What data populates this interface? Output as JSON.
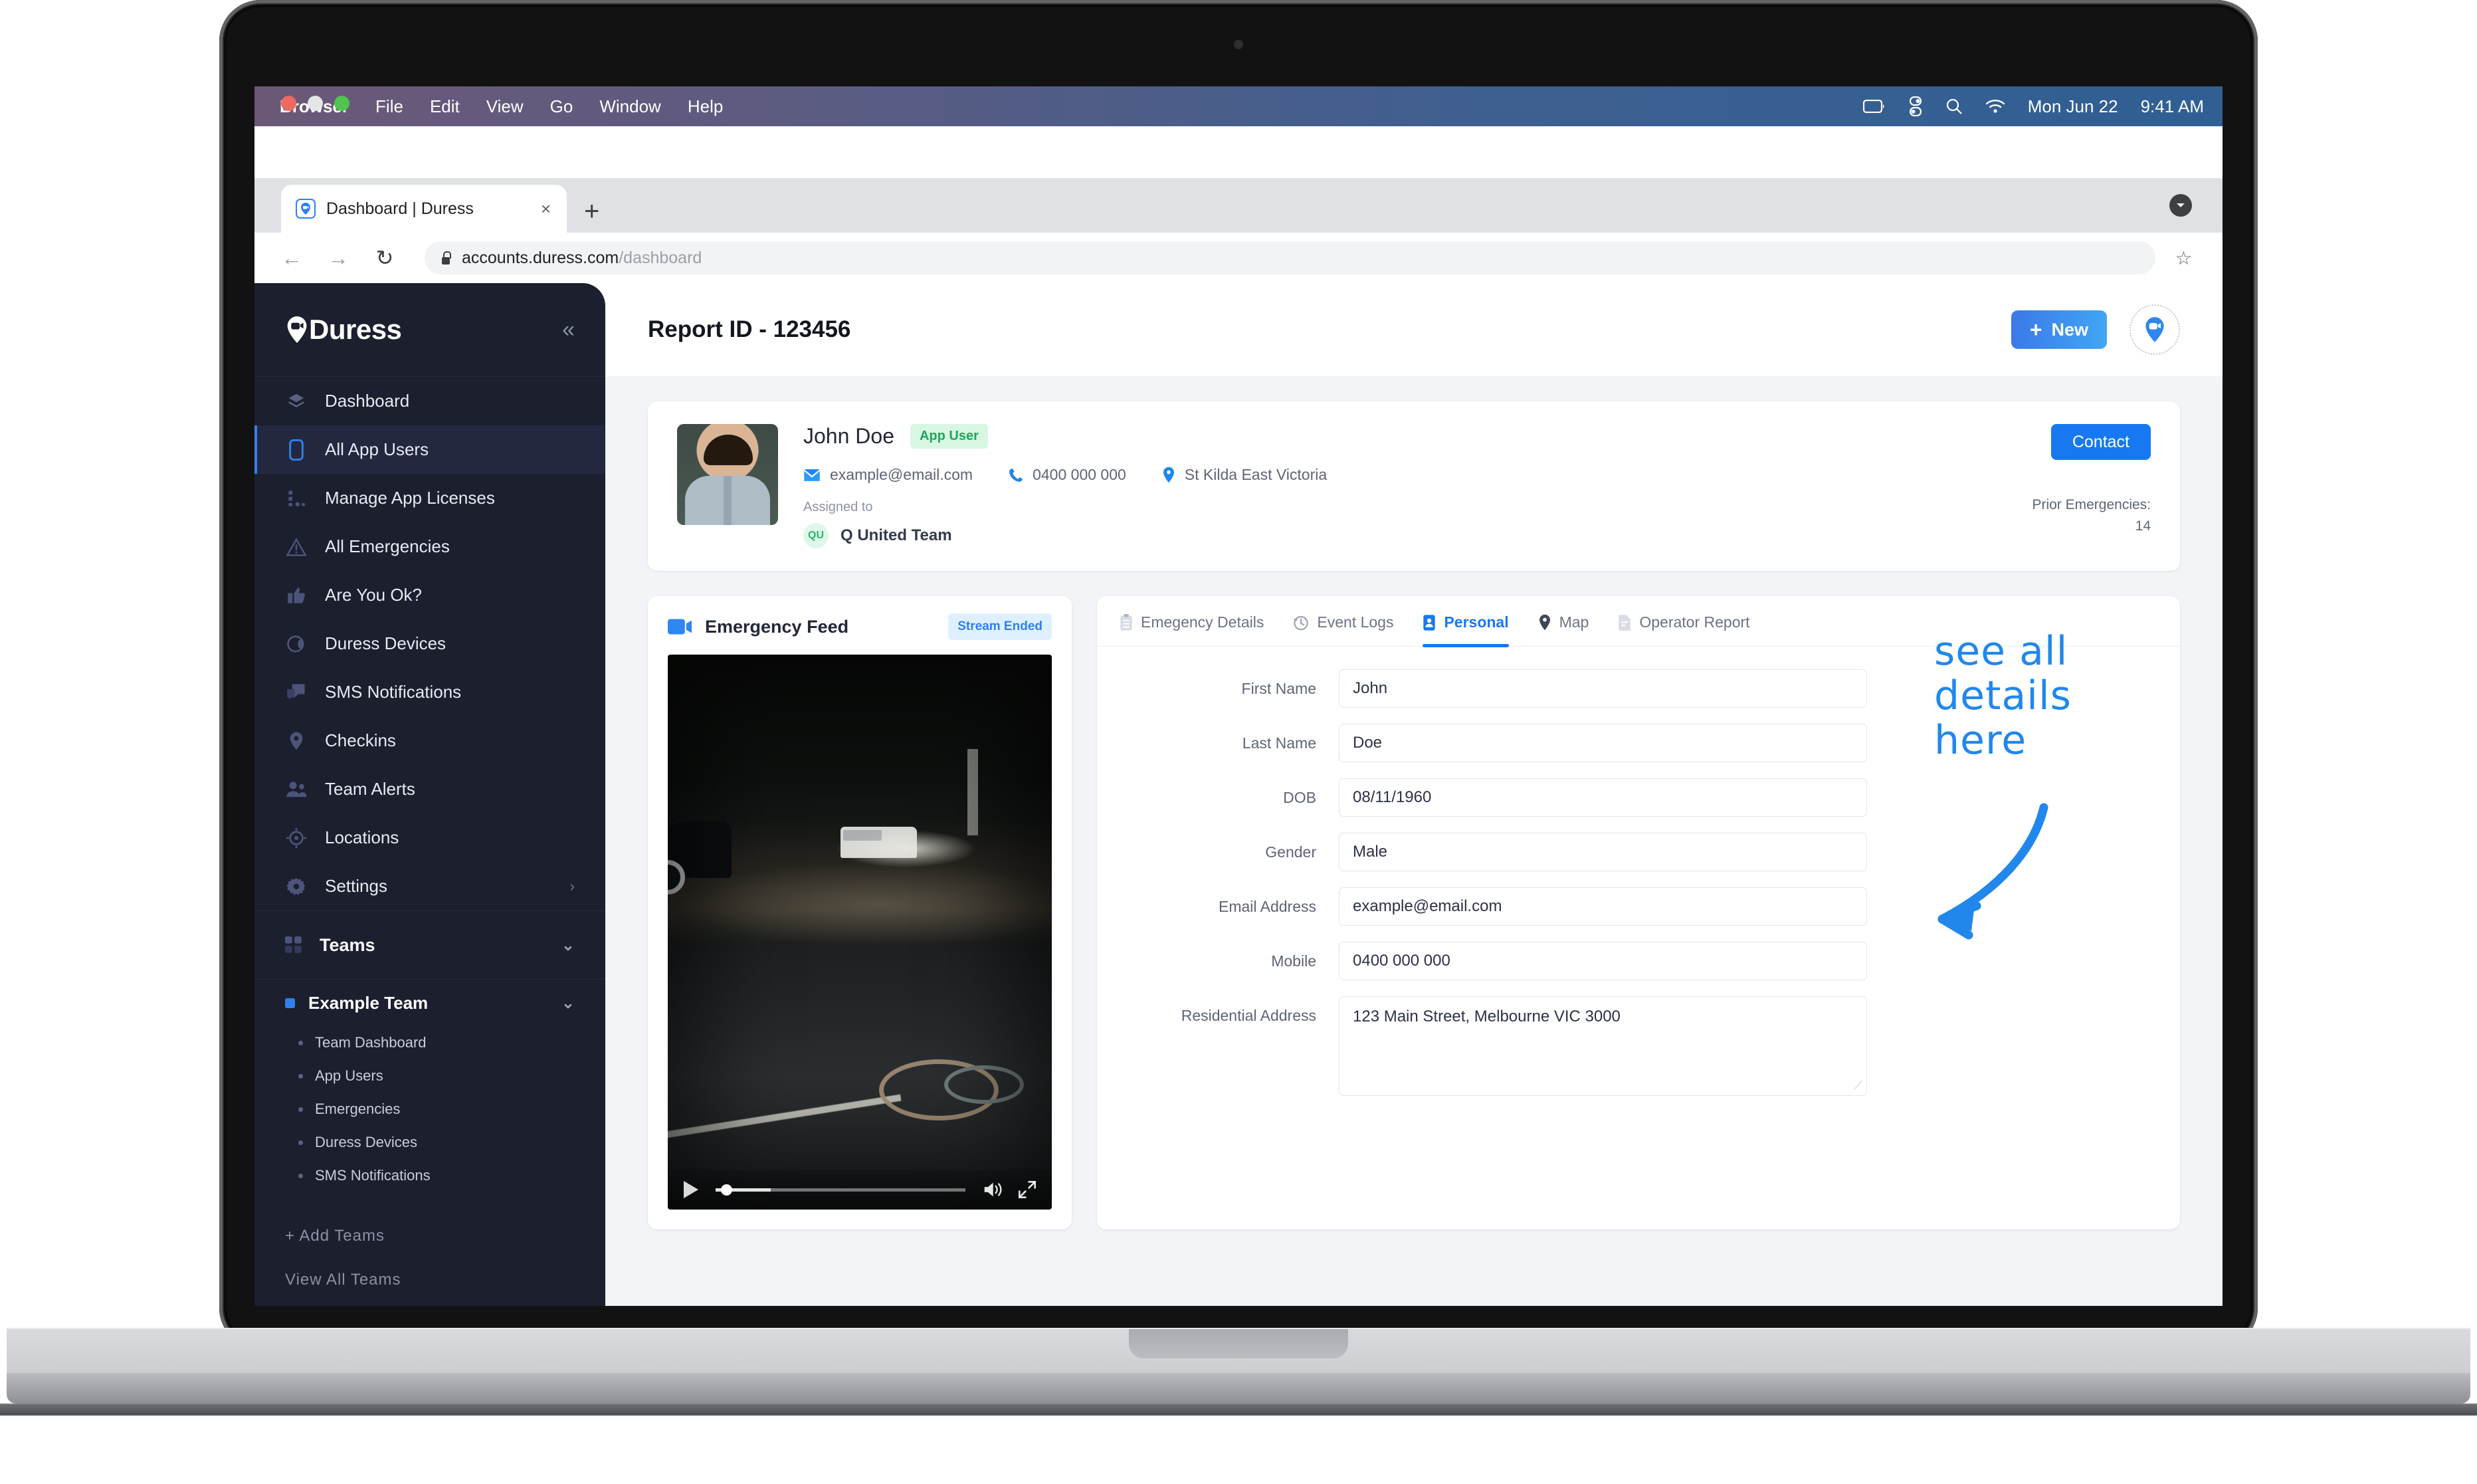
{
  "os_menubar": {
    "items": [
      "Browser",
      "File",
      "Edit",
      "View",
      "Go",
      "Window",
      "Help"
    ],
    "status_icons": [
      "battery-icon",
      "control-center-icon",
      "search-icon",
      "wifi-icon"
    ],
    "date": "Mon Jun 22",
    "time": "9:41 AM"
  },
  "browser": {
    "tab_title": "Dashboard | Duress",
    "tab_favicon": "duress-pin-icon",
    "tab_close": "×",
    "new_tab": "+",
    "back": "←",
    "forward": "→",
    "reload": "↻",
    "url_host": "accounts.duress.com",
    "url_path": "/dashboard",
    "bookmark": "☆",
    "menu": "chrome-menu-icon"
  },
  "sidebar": {
    "brand": "Duress",
    "collapse": "«",
    "items": [
      {
        "label": "Dashboard",
        "icon": "layers-icon",
        "active": false
      },
      {
        "label": "All App Users",
        "icon": "phone-icon",
        "active": true
      },
      {
        "label": "Manage App Licenses",
        "icon": "grid-dots-icon",
        "active": false
      },
      {
        "label": "All Emergencies",
        "icon": "warning-triangle-icon",
        "active": false
      },
      {
        "label": "Are You Ok?",
        "icon": "thumbs-up-icon",
        "active": false
      },
      {
        "label": "Duress Devices",
        "icon": "device-circle-icon",
        "active": false
      },
      {
        "label": "SMS Notifications",
        "icon": "chat-bubbles-icon",
        "active": false
      },
      {
        "label": "Checkins",
        "icon": "map-pin-icon",
        "active": false
      },
      {
        "label": "Team Alerts",
        "icon": "people-icon",
        "active": false
      },
      {
        "label": "Locations",
        "icon": "crosshair-icon",
        "active": false
      },
      {
        "label": "Settings",
        "icon": "gear-icon",
        "active": false,
        "chevron": "›"
      }
    ],
    "teams_section": {
      "label": "Teams",
      "icon": "grid-squares-icon",
      "chevron": "⌄"
    },
    "team": {
      "label": "Example Team",
      "chevron": "⌄"
    },
    "team_children": [
      "Team Dashboard",
      "App Users",
      "Emergencies",
      "Duress Devices",
      "SMS Notifications"
    ],
    "add_teams": "+ Add Teams",
    "view_all_teams": "View All Teams"
  },
  "topbar": {
    "title": "Report ID - 123456",
    "new_button": "New",
    "new_button_plus": "+",
    "avatar_icon": "duress-pin-icon"
  },
  "profile": {
    "name": "John Doe",
    "badge": "App User",
    "email": "example@email.com",
    "phone": "0400 000 000",
    "location": "St Kilda East Victoria",
    "assigned_to_label": "Assigned to",
    "team_initials": "QU",
    "team_name": "Q United Team",
    "contact_button": "Contact",
    "prior_emergencies_label": "Prior Emergencies:",
    "prior_emergencies_value": "14"
  },
  "feed": {
    "title": "Emergency Feed",
    "icon": "video-camera-icon",
    "status_chip": "Stream Ended",
    "controls": {
      "play": "play-icon",
      "volume": "volume-icon",
      "fullscreen": "fullscreen-icon"
    }
  },
  "detail_tabs": [
    {
      "label": "Emegency Details",
      "icon": "clipboard-icon",
      "active": false
    },
    {
      "label": "Event Logs",
      "icon": "history-clock-icon",
      "active": false
    },
    {
      "label": "Personal",
      "icon": "contact-card-icon",
      "active": true
    },
    {
      "label": "Map",
      "icon": "map-pin-icon",
      "active": false
    },
    {
      "label": "Operator Report",
      "icon": "report-doc-icon",
      "active": false
    }
  ],
  "personal_form": {
    "fields": [
      {
        "label": "First Name",
        "value": "John",
        "type": "text"
      },
      {
        "label": "Last Name",
        "value": "Doe",
        "type": "text"
      },
      {
        "label": "DOB",
        "value": "08/11/1960",
        "type": "text"
      },
      {
        "label": "Gender",
        "value": "Male",
        "type": "text"
      },
      {
        "label": "Email Address",
        "value": "example@email.com",
        "type": "text"
      },
      {
        "label": "Mobile",
        "value": "0400 000 000",
        "type": "text"
      },
      {
        "label": "Residential Address",
        "value": "123 Main Street, Melbourne VIC 3000",
        "type": "textarea"
      }
    ]
  },
  "annotation": {
    "line1": "see all",
    "line2": "details",
    "line3": "here",
    "color": "#2187ec"
  },
  "colors": {
    "accent": "#1878f2",
    "sidebar_bg": "#1b1f2e",
    "page_bg": "#f2f4f8",
    "badge_green": "#22a45d",
    "chip_blue": "#2f80ed"
  }
}
